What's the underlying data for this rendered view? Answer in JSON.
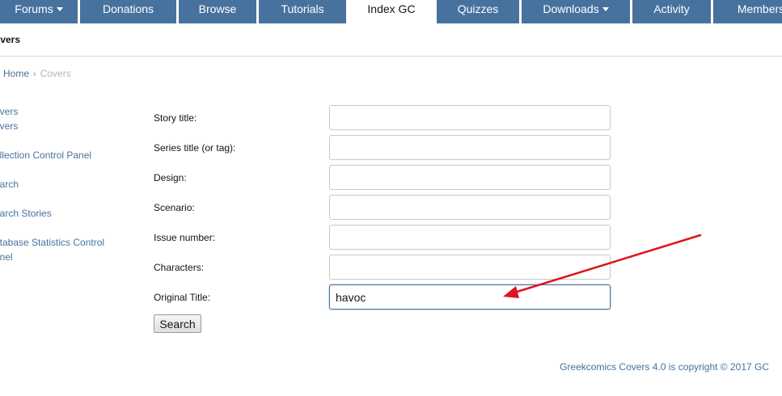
{
  "nav": {
    "tabs": [
      {
        "label": "Forums",
        "dropdown": true
      },
      {
        "label": "Donations"
      },
      {
        "label": "Browse"
      },
      {
        "label": "Tutorials"
      },
      {
        "label": "Index GC",
        "active": true
      },
      {
        "label": "Quizzes"
      },
      {
        "label": "Downloads",
        "dropdown": true
      },
      {
        "label": "Activity"
      },
      {
        "label": "Members"
      }
    ]
  },
  "header": {
    "title": "overs"
  },
  "breadcrumb": {
    "home": "Home",
    "current": "Covers"
  },
  "sidebar": {
    "items": [
      {
        "label": "overs"
      },
      {
        "label": "overs"
      },
      {
        "label": "ollection Control Panel"
      },
      {
        "label": "earch"
      },
      {
        "label": "earch Stories"
      },
      {
        "label": "atabase Statistics Control"
      },
      {
        "label": "anel"
      }
    ]
  },
  "form": {
    "fields": [
      {
        "label": "Story title:",
        "value": ""
      },
      {
        "label": "Series title (or tag):",
        "value": ""
      },
      {
        "label": "Design:",
        "value": ""
      },
      {
        "label": "Scenario:",
        "value": ""
      },
      {
        "label": "Issue number:",
        "value": ""
      },
      {
        "label": "Characters:",
        "value": ""
      },
      {
        "label": "Original Title:",
        "value": "havoc"
      }
    ],
    "search_label": "Search"
  },
  "footer": {
    "copyright": "Greekcomics Covers 4.0 is copyright © 2017 GC"
  },
  "colors": {
    "brand": "#47729e",
    "annotation_arrow": "#e0141e"
  },
  "icons": {
    "dropdown": "caret-down-icon",
    "breadcrumb_separator": "chevron-right-icon"
  }
}
